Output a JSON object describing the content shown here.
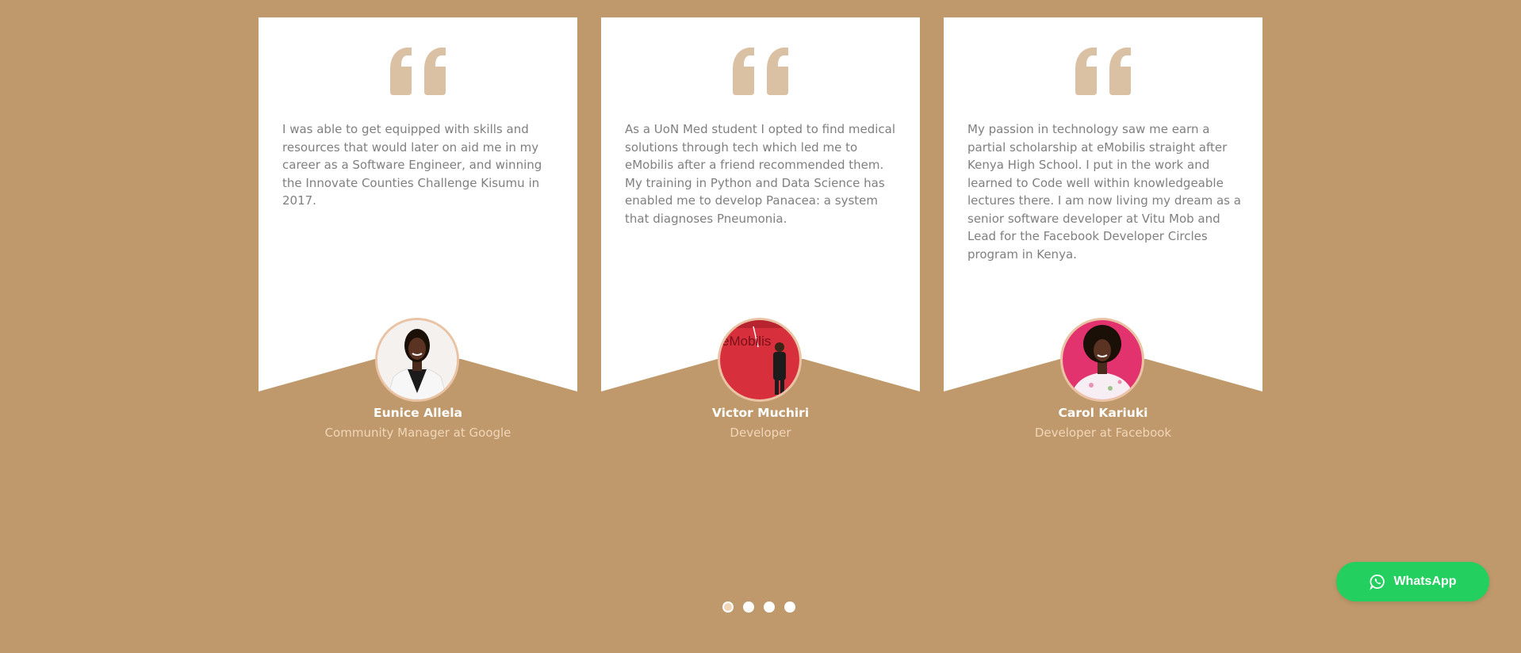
{
  "colors": {
    "background": "#bf996b",
    "card": "#ffffff",
    "quote_icon": "#dbc1a4",
    "name": "#ffffff",
    "role": "#f1d6b9",
    "whatsapp": "#23cf5f"
  },
  "testimonials": [
    {
      "quote": "I was able to get equipped with skills and resources that would later on aid me in my career as a Software Engineer, and winning the Innovate Counties Challenge Kisumu in 2017.",
      "name": "Eunice Allela",
      "role": "Community Manager at Google",
      "icon": "quote-icon"
    },
    {
      "quote": "As a UoN Med student I opted to find medical solutions through tech which led me to eMobilis after a friend recommended them. My training in Python and Data Science has enabled me to develop Panacea: a system that diagnoses Pneumonia.",
      "name": "Victor Muchiri",
      "role": "Developer",
      "icon": "quote-icon",
      "photo_sign": "eMobilis"
    },
    {
      "quote": "My passion in technology saw me earn a partial scholarship at eMobilis straight after Kenya High School. I put in the work and learned to Code well within knowledgeable lectures there. I am now living my dream as a senior software developer at Vitu Mob and Lead for the Facebook Developer Circles program in Kenya.",
      "name": "Carol Kariuki",
      "role": "Developer at Facebook",
      "icon": "quote-icon"
    }
  ],
  "pagination": {
    "count": 4,
    "active": 1
  },
  "whatsapp": {
    "label": "WhatsApp",
    "icon": "whatsapp-icon"
  }
}
